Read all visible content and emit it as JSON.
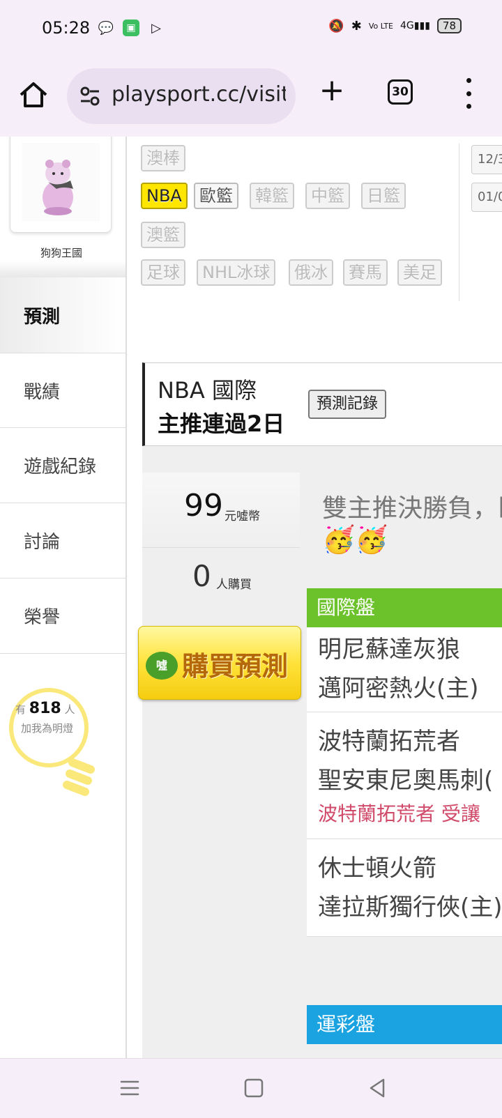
{
  "status": {
    "time": "05:28",
    "battery": "78",
    "network": "4G",
    "volte": "Vo LTE"
  },
  "browser": {
    "url": "playsport.cc/visit",
    "tab_count": "30"
  },
  "sidebar": {
    "profile_name": "狗狗王國",
    "tabs": [
      {
        "label": "預測",
        "active": true
      },
      {
        "label": "戰績",
        "active": false
      },
      {
        "label": "遊戲紀錄",
        "active": false
      },
      {
        "label": "討論",
        "active": false
      },
      {
        "label": "榮譽",
        "active": false
      }
    ],
    "fans": {
      "prefix": "有",
      "count": "818",
      "suffix": "人",
      "line2": "加我為明燈"
    }
  },
  "filters": {
    "row0": [
      "澳棒"
    ],
    "row1": [
      "NBA",
      "歐籃",
      "韓籃",
      "中籃",
      "日籃"
    ],
    "row2": [
      "澳籃"
    ],
    "row3": [
      "足球",
      "NHL冰球",
      "俄冰",
      "賽馬",
      "美足"
    ],
    "selected": "NBA",
    "dates": [
      "12/3",
      "01/0"
    ]
  },
  "prediction": {
    "league": "NBA 國際",
    "streak": "主推連過2日",
    "record_button": "預測記錄"
  },
  "purchase": {
    "price": "99",
    "price_unit": "元噓幣",
    "buyers": "0",
    "buyers_unit": "人購買",
    "buy_button": "購買預測",
    "coin_label": "噓"
  },
  "content": {
    "headline": "雙主推決勝負，卧",
    "emojis": "🥳🥳",
    "section_international": "國際盤",
    "section_lottery": "運彩盤",
    "matches": [
      {
        "away": "明尼蘇達灰狼",
        "home": "邁阿密熱火(主)",
        "note": ""
      },
      {
        "away": "波特蘭拓荒者",
        "home": "聖安東尼奧馬刺(",
        "note": "波特蘭拓荒者 受讓"
      },
      {
        "away": "休士頓火箭",
        "home": "達拉斯獨行俠(主)",
        "note": ""
      }
    ]
  },
  "colors": {
    "accent_yellow": "#ffe600",
    "section_green": "#6cc22a",
    "section_blue": "#1aa3e0",
    "note_red": "#d04a6a"
  }
}
